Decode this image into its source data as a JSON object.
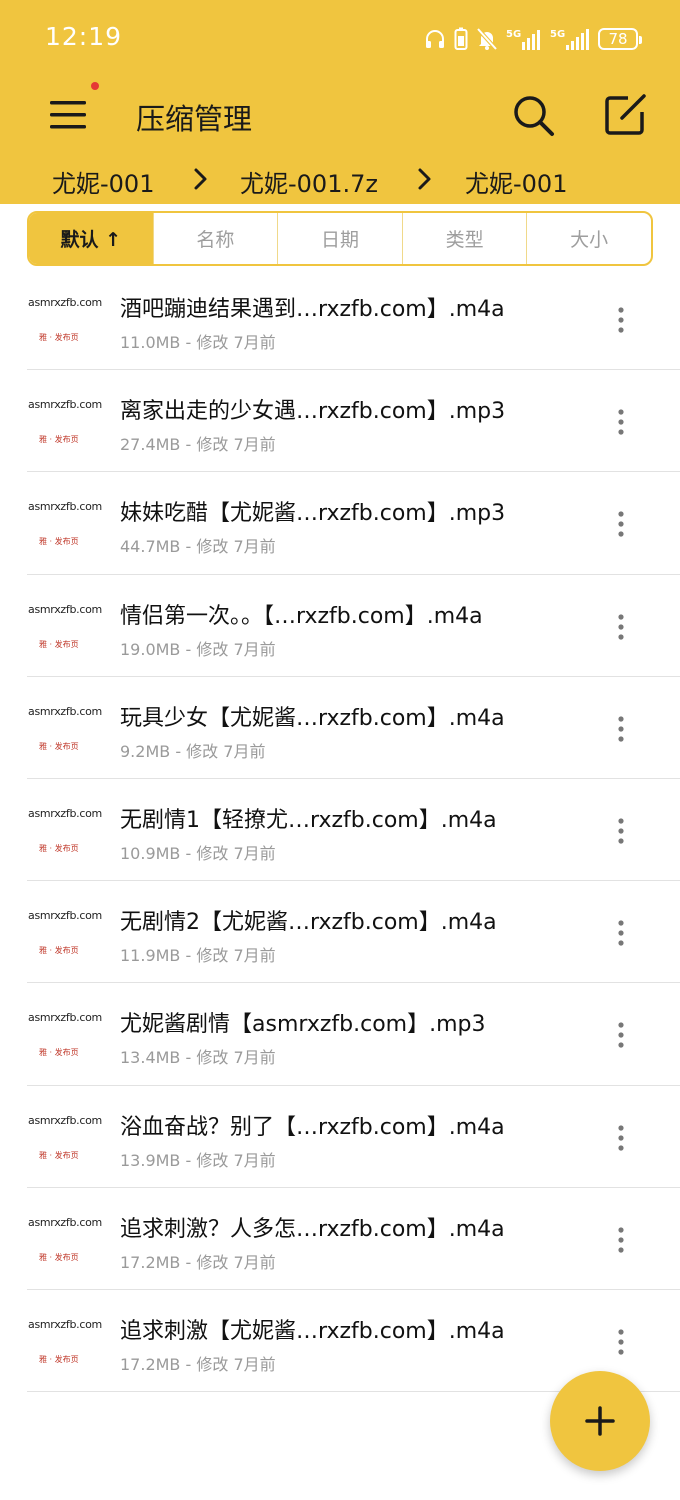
{
  "status_bar": {
    "time": "12:19",
    "battery": "78",
    "icons": [
      "headphones-icon",
      "battery-saver-icon",
      "mute-icon",
      "signal-5g-icon",
      "signal-5g-icon"
    ]
  },
  "toolbar": {
    "title": "压缩管理",
    "menu_icon": "menu-icon",
    "search_icon": "search-icon",
    "edit_icon": "edit-icon",
    "notification_dot_color": "#e53935"
  },
  "breadcrumb": [
    "尤妮-001",
    "尤妮-001.7z",
    "尤妮-001"
  ],
  "sort_tabs": [
    {
      "label": "默认 ↑",
      "active": true
    },
    {
      "label": "名称",
      "active": false
    },
    {
      "label": "日期",
      "active": false
    },
    {
      "label": "类型",
      "active": false
    },
    {
      "label": "大小",
      "active": false
    }
  ],
  "thumbnail": {
    "top": "asmrxzfb.com",
    "bottom": "雅 · 发布页"
  },
  "files": [
    {
      "name": "酒吧蹦迪结果遇到…rxzfb.com】.m4a",
      "meta": "11.0MB - 修改 7月前"
    },
    {
      "name": "离家出走的少女遇…rxzfb.com】.mp3",
      "meta": "27.4MB - 修改 7月前"
    },
    {
      "name": "妹妹吃醋【尤妮酱…rxzfb.com】.mp3",
      "meta": "44.7MB - 修改 7月前"
    },
    {
      "name": "情侣第一次。。【…rxzfb.com】.m4a",
      "meta": "19.0MB - 修改 7月前"
    },
    {
      "name": "玩具少女【尤妮酱…rxzfb.com】.m4a",
      "meta": "9.2MB - 修改 7月前"
    },
    {
      "name": "无剧情1【轻撩尤…rxzfb.com】.m4a",
      "meta": "10.9MB - 修改 7月前"
    },
    {
      "name": "无剧情2【尤妮酱…rxzfb.com】.m4a",
      "meta": "11.9MB - 修改 7月前"
    },
    {
      "name": "尤妮酱剧情【asmrxzfb.com】.mp3",
      "meta": "13.4MB - 修改 7月前"
    },
    {
      "name": "浴血奋战？别了【…rxzfb.com】.m4a",
      "meta": "13.9MB - 修改 7月前"
    },
    {
      "name": "追求刺激？人多怎…rxzfb.com】.m4a",
      "meta": "17.2MB - 修改 7月前"
    },
    {
      "name": "追求刺激【尤妮酱…rxzfb.com】.m4a",
      "meta": "17.2MB - 修改 7月前"
    }
  ],
  "fab": {
    "icon": "plus-icon"
  },
  "colors": {
    "accent": "#f0c53f",
    "divider": "#e2e2e2",
    "meta_text": "#9a9a9a"
  }
}
